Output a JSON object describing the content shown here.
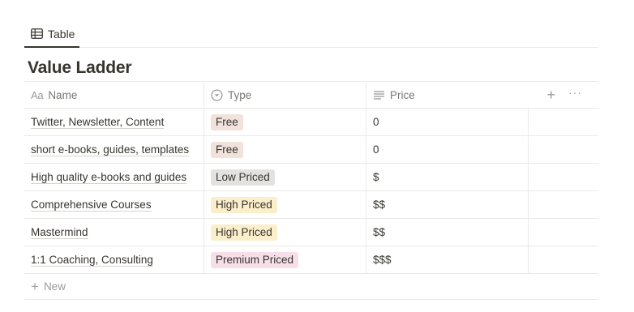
{
  "view_tab": {
    "label": "Table",
    "icon": "table-icon"
  },
  "title": "Value Ladder",
  "columns": {
    "name": {
      "prefix": "Aa",
      "label": "Name"
    },
    "type": {
      "label": "Type",
      "icon": "select-icon"
    },
    "price": {
      "label": "Price",
      "icon": "text-lines-icon"
    }
  },
  "header_actions": {
    "add": "+",
    "more": "···"
  },
  "rows": [
    {
      "name": "Twitter, Newsletter, Content",
      "type": "Free",
      "type_color": "#f1e2dc",
      "price": "0"
    },
    {
      "name": "short e-books, guides, templates",
      "type": "Free",
      "type_color": "#f1e2dc",
      "price": "0"
    },
    {
      "name": "High quality e-books and guides",
      "type": "Low Priced",
      "type_color": "#e3e2e0",
      "price": "$"
    },
    {
      "name": "Comprehensive Courses",
      "type": "High Priced",
      "type_color": "#fbeecb",
      "price": "$$"
    },
    {
      "name": "Mastermind",
      "type": "High Priced",
      "type_color": "#fbeecb",
      "price": "$$"
    },
    {
      "name": "1:1 Coaching, Consulting",
      "type": "Premium Priced",
      "type_color": "#f6dfe8",
      "price": "$$$"
    }
  ],
  "new_row": {
    "plus": "+",
    "label": "New"
  }
}
